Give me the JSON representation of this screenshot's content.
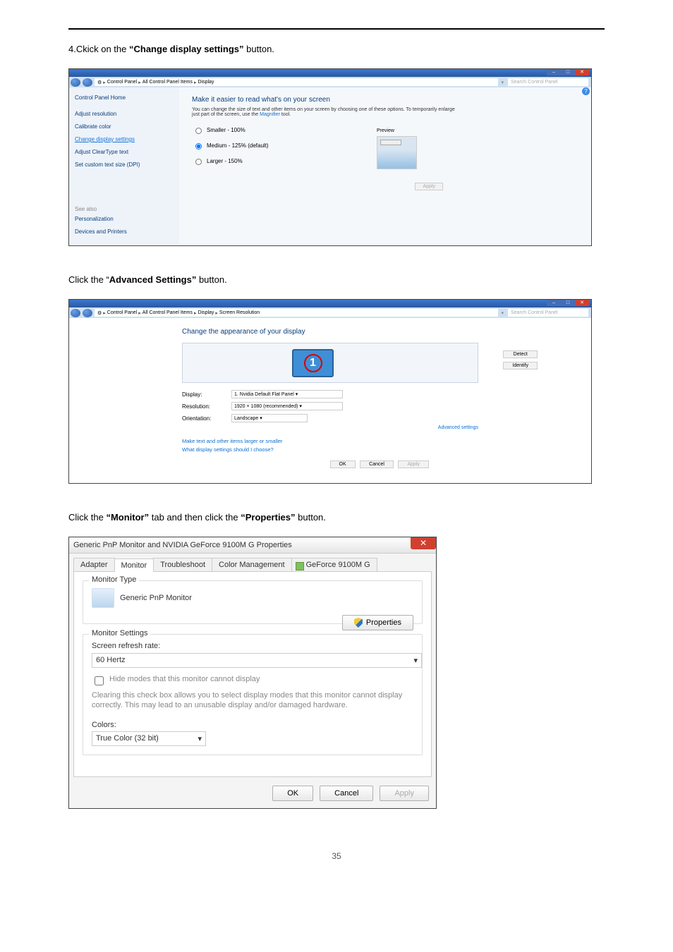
{
  "page_number": "35",
  "step1_prefix": "4.Ckick on the ",
  "step1_bold": "“Change display settings”",
  "step1_suffix": " button.",
  "step2_prefix": "Click the “",
  "step2_bold": "Advanced Settings”",
  "step2_suffix": " button.",
  "step3_prefix": "Click the ",
  "step3_bold1": "“Monitor”",
  "step3_mid": " tab and then click the ",
  "step3_bold2": "“Properties”",
  "step3_suffix": " button.",
  "win1": {
    "breadcrumb": [
      "Control Panel",
      "All Control Panel Items",
      "Display"
    ],
    "search_placeholder": "Search Control Panel",
    "sidebar": {
      "home": "Control Panel Home",
      "items": [
        "Adjust resolution",
        "Calibrate color",
        "Change display settings",
        "Adjust ClearType text",
        "Set custom text size (DPI)"
      ],
      "see_also": "See also",
      "see_items": [
        "Personalization",
        "Devices and Printers"
      ]
    },
    "heading": "Make it easier to read what's on your screen",
    "desc_a": "You can change the size of text and other items on your screen by choosing one of these options. To temporarily enlarge just part of the screen, use the ",
    "desc_link": "Magnifier",
    "desc_b": " tool.",
    "radios": [
      "Smaller - 100%",
      "Medium - 125% (default)",
      "Larger - 150%"
    ],
    "preview_label": "Preview",
    "apply": "Apply"
  },
  "win2": {
    "breadcrumb": [
      "Control Panel",
      "All Control Panel Items",
      "Display",
      "Screen Resolution"
    ],
    "search_placeholder": "Search Control Panel",
    "heading": "Change the appearance of your display",
    "detect": "Detect",
    "identify": "Identify",
    "monitor_num": "1",
    "fields": {
      "display_lbl": "Display:",
      "display_val": "1. Nvidia Default Flat Panel",
      "res_lbl": "Resolution:",
      "res_val": "1920 × 1080 (recommended)",
      "orient_lbl": "Orientation:",
      "orient_val": "Landscape"
    },
    "adv_link": "Advanced settings",
    "link1": "Make text and other items larger or smaller",
    "link2": "What display settings should I choose?",
    "ok": "OK",
    "cancel": "Cancel",
    "apply": "Apply"
  },
  "win3": {
    "title": "Generic PnP Monitor and NVIDIA GeForce 9100M G   Properties",
    "tabs": [
      "Adapter",
      "Monitor",
      "Troubleshoot",
      "Color Management",
      "GeForce 9100M G"
    ],
    "grp1": "Monitor Type",
    "monitor_name": "Generic PnP Monitor",
    "properties_btn": "Properties",
    "grp2": "Monitor Settings",
    "refresh_lbl": "Screen refresh rate:",
    "refresh_val": "60 Hertz",
    "hide_modes": "Hide modes that this monitor cannot display",
    "hint": "Clearing this check box allows you to select display modes that this monitor cannot display correctly. This may lead to an unusable display and/or damaged hardware.",
    "colors_lbl": "Colors:",
    "colors_val": "True Color (32 bit)",
    "ok": "OK",
    "cancel": "Cancel",
    "apply": "Apply"
  }
}
